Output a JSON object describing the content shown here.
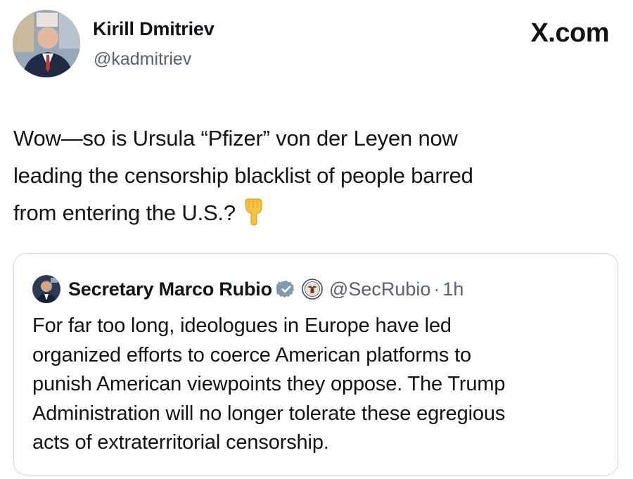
{
  "author": {
    "name": "Kirill Dmitriev",
    "handle": "@kadmitriev"
  },
  "site_label": "X.com",
  "tweet": {
    "lines": [
      "Wow—so is Ursula “Pfizer” von der Leyen now",
      "leading the censorship blacklist of people barred",
      "from entering the U.S.?"
    ],
    "emoji": "backhand-index-pointing-down"
  },
  "quoted_tweet": {
    "name": "Secretary Marco Rubio",
    "verified_badge": "verified-icon",
    "affiliate_badge": "us-state-department-seal",
    "handle": "@SecRubio",
    "separator": "·",
    "time": "1h",
    "lines": [
      "For far too long, ideologues in Europe have led",
      "organized efforts to coerce American platforms to",
      "punish American viewpoints they oppose. The Trump",
      "Administration will no longer tolerate these egregious",
      "acts of extraterritorial censorship."
    ]
  },
  "colors": {
    "text": "#0f1419",
    "secondary_text": "#536471",
    "verified_badge": "#829aab",
    "card_border": "#cfd9de",
    "emoji_yellow": "#f6c342"
  }
}
